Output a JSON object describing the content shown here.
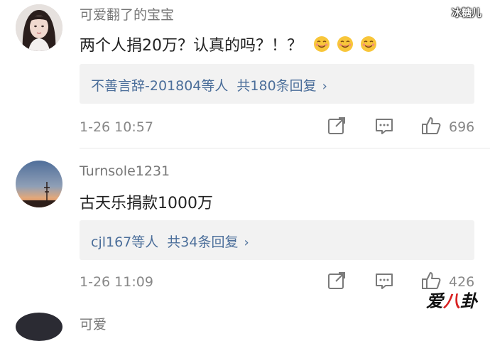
{
  "watermark_top": "冰糖儿",
  "watermark_bottom": {
    "part1": "爱",
    "part2": "八",
    "part3": "卦"
  },
  "comments": [
    {
      "username": "可爱翻了的宝宝",
      "text": "两个人捐20万？认真的吗？！？",
      "emoji": "smiling-face-icon",
      "reply_users": "不善言辞-201804等人",
      "reply_count": "共180条回复",
      "time": "1-26 10:57",
      "likes": "696"
    },
    {
      "username": "Turnsole1231",
      "text": "古天乐捐款1000万",
      "reply_users": "cjl167等人",
      "reply_count": "共34条回复",
      "time": "1-26 11:09",
      "likes": "426"
    }
  ],
  "next_comment": {
    "username": "可爱"
  }
}
